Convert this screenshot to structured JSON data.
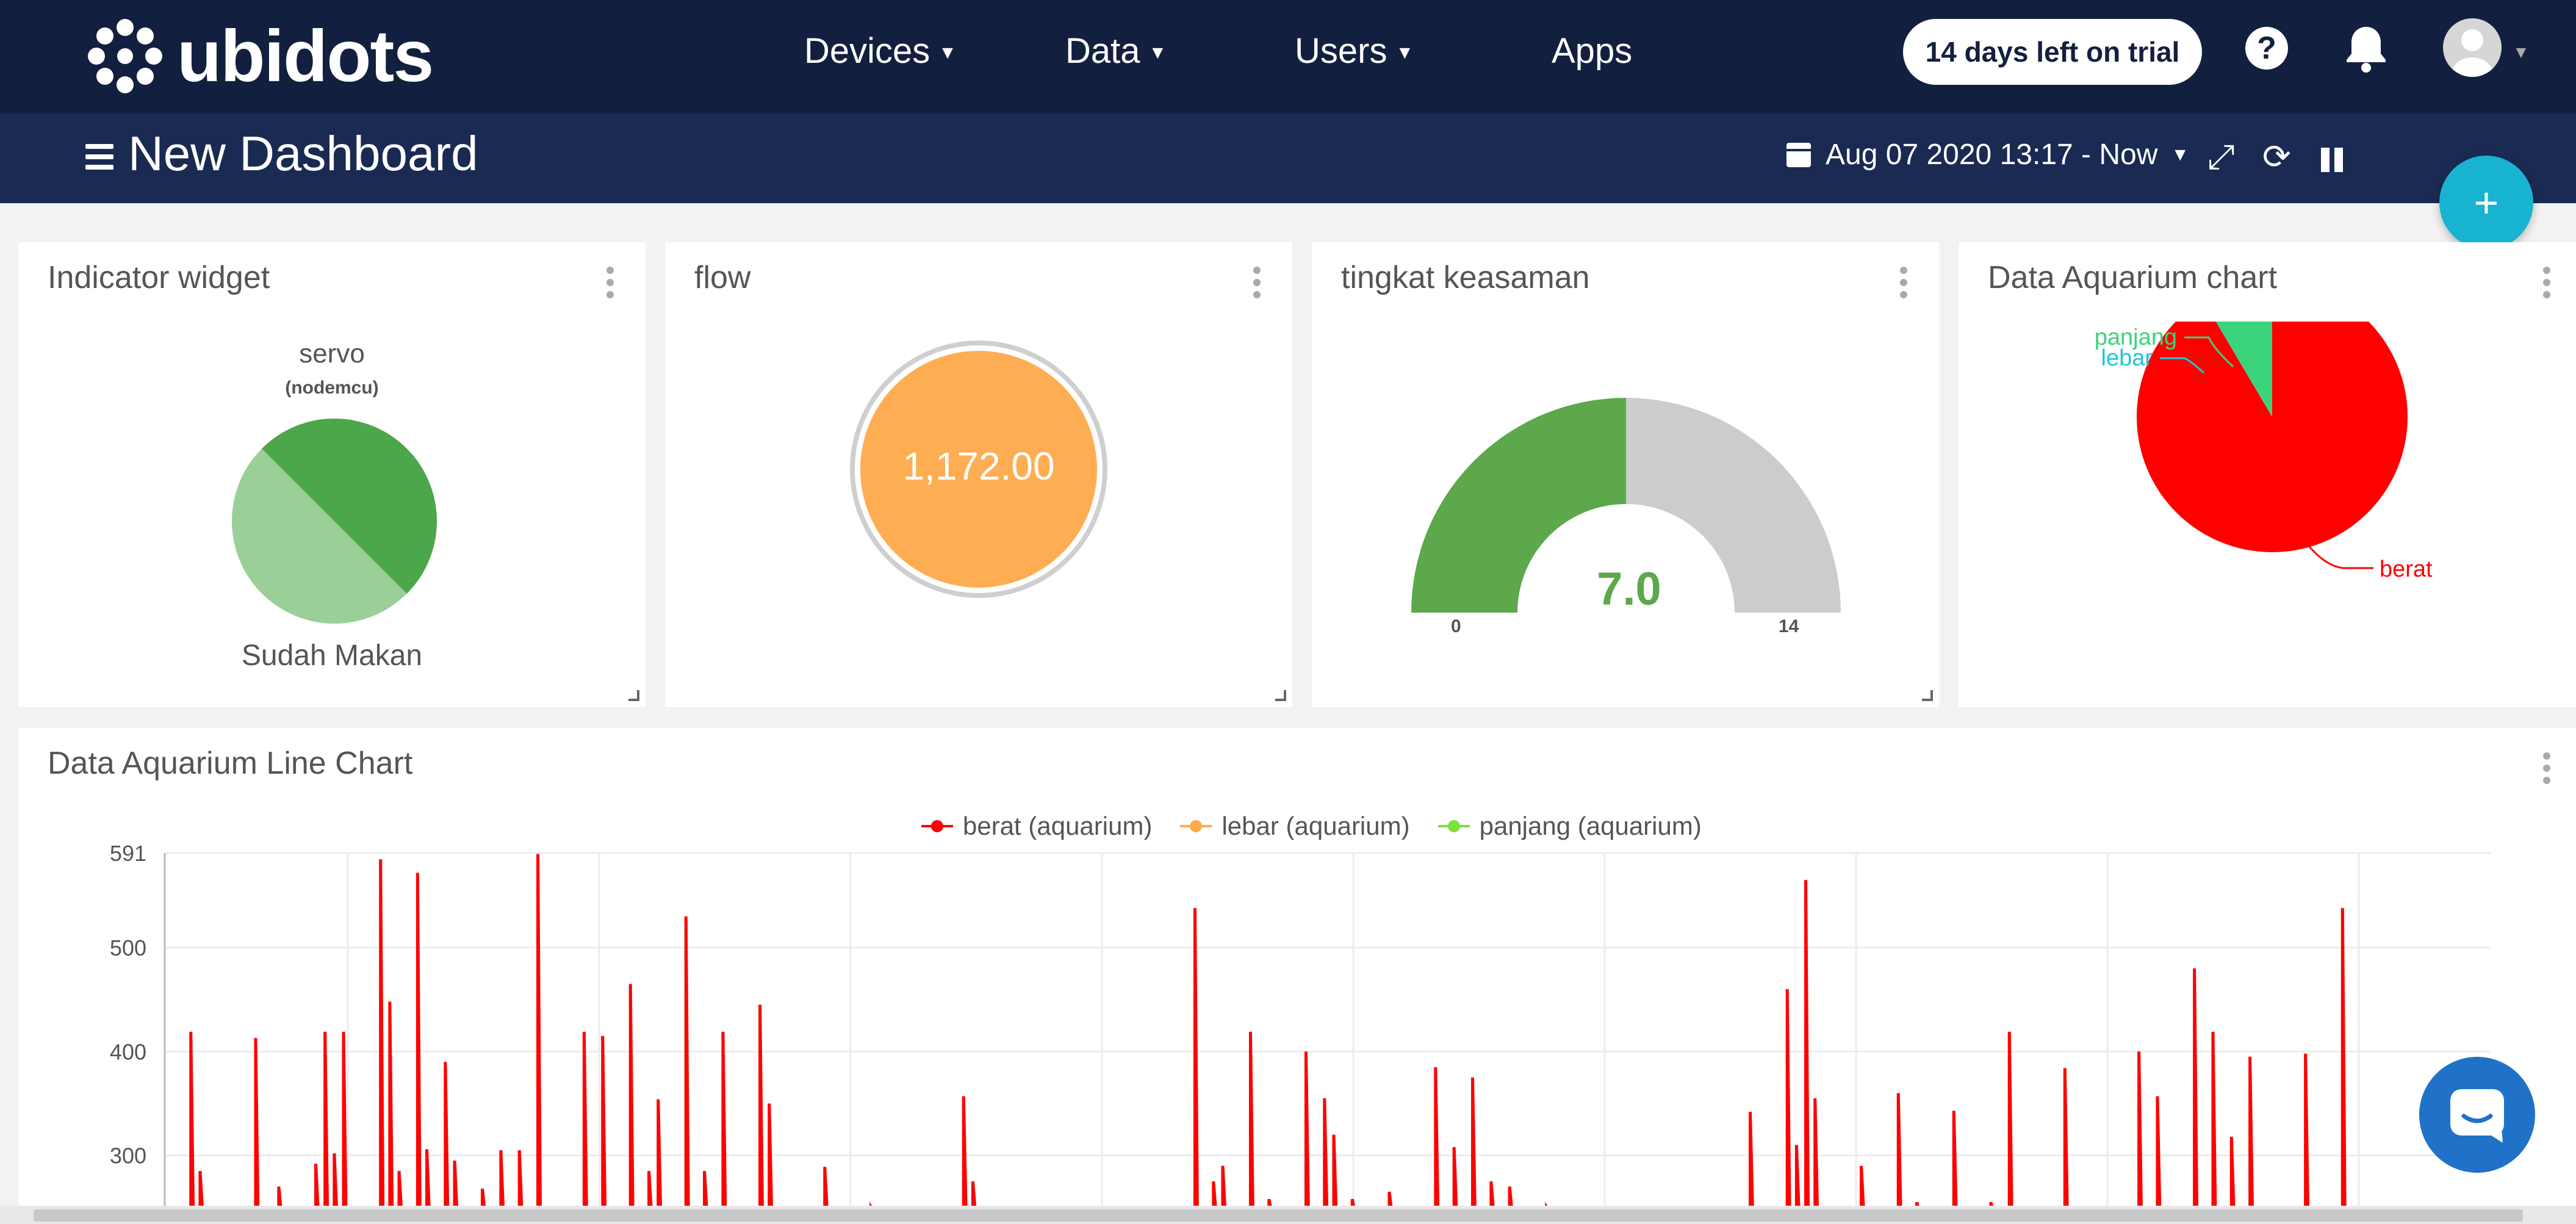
{
  "app": {
    "logo_text": "ubidots"
  },
  "nav": {
    "devices": "Devices",
    "data": "Data",
    "users": "Users",
    "apps": "Apps"
  },
  "trial": "14 days left on trial",
  "dashboard": {
    "title": "New Dashboard",
    "date_range": "Aug 07 2020 13:17 - Now",
    "add_label": "+"
  },
  "widgets": {
    "indicator": {
      "title": "Indicator widget",
      "variable": "servo",
      "device": "(nodemcu)",
      "status": "Sudah Makan"
    },
    "flow": {
      "title": "flow",
      "value": "1,172.00"
    },
    "gauge": {
      "title": "tingkat keasaman",
      "value": "7.0",
      "min": "0",
      "max": "14",
      "value_num": 7.0,
      "min_num": 0,
      "max_num": 14
    },
    "pie": {
      "title": "Data Aquarium chart"
    },
    "line": {
      "title": "Data Aquarium Line Chart"
    }
  },
  "colors": {
    "navy": "#131f3f",
    "navy2": "#1a2a52",
    "accent": "#17b3d1",
    "berat": "#ff0000",
    "lebar": "#ffab4d",
    "panjang": "#7ee03c",
    "gauge": "#5ca84b",
    "flow": "#fead52"
  },
  "chart_data": [
    {
      "type": "pie",
      "title": "Data Aquarium chart",
      "labels": [
        "berat",
        "lebar",
        "panjang"
      ],
      "values": [
        91.5,
        0.1,
        8.4
      ],
      "colors": [
        "#ff0000",
        "#1fc6d6",
        "#3bd47b"
      ]
    },
    {
      "type": "line",
      "title": "Data Aquarium Line Chart",
      "series": [
        {
          "name": "berat  (aquarium)",
          "color": "#ff0000",
          "x": [
            3,
            5,
            17,
            22,
            24,
            26,
            30,
            32,
            34,
            36,
            40,
            44,
            46,
            48,
            52,
            54,
            56,
            58,
            60,
            62,
            66,
            70,
            74,
            78,
            82,
            88,
            92,
            98,
            102,
            104,
            106,
            110,
            114,
            118,
            120,
            122,
            126,
            128,
            130,
            132,
            134,
            136,
            140,
            144,
            148,
            150,
            152,
            154,
            156,
            160,
            164,
            168,
            170,
            172,
            178,
            180,
            182,
            186,
            190,
            194,
            200,
            204,
            208,
            210,
            212,
            216,
            218,
            220,
            224,
            226,
            228,
            232,
            236,
            240,
            244,
            248,
            250,
            252,
            254,
            256,
            258,
            262,
            264,
            266,
            268,
            272,
            276,
            280,
            282,
            284,
            288,
            292,
            296,
            300,
            304,
            310,
            314,
            316,
            320,
            324,
            330,
            336,
            340,
            344,
            348,
            350,
            352,
            354,
            356,
            360,
            364,
            368,
            372,
            376,
            380,
            384,
            388,
            392,
            396,
            400,
            404,
            408,
            412,
            416,
            420,
            424,
            428,
            430,
            432,
            436,
            440,
            444,
            448,
            452,
            456,
            460,
            464,
            468,
            472,
            476,
            480,
            484,
            488,
            490,
            494,
            498
          ],
          "y": [
            419,
            285,
            413,
            270,
            236,
            230,
            292,
            419,
            302,
            419,
            240,
            585,
            448,
            285,
            572,
            306,
            233,
            390,
            295,
            225,
            268,
            305,
            305,
            590,
            240,
            419,
            415,
            465,
            285,
            354,
            230,
            530,
            285,
            419,
            230,
            230,
            445,
            350,
            230,
            220,
            225,
            230,
            289,
            240,
            230,
            250,
            225,
            230,
            230,
            230,
            230,
            230,
            357,
            275,
            230,
            230,
            230,
            230,
            230,
            230,
            230,
            230,
            230,
            230,
            230,
            230,
            230,
            538,
            275,
            290,
            230,
            419,
            258,
            240,
            400,
            355,
            320,
            230,
            258,
            240,
            230,
            265,
            230,
            230,
            230,
            385,
            308,
            375,
            230,
            275,
            270,
            230,
            250,
            230,
            230,
            230,
            230,
            230,
            230,
            230,
            230,
            230,
            342,
            230,
            460,
            310,
            565,
            355,
            230,
            230,
            290,
            230,
            360,
            255,
            230,
            343,
            230,
            255,
            419,
            230,
            230,
            384,
            230,
            230,
            230,
            400,
            357,
            230,
            230,
            480,
            419,
            318,
            395,
            230,
            230,
            398,
            230,
            538,
            230,
            230,
            230,
            230,
            230,
            230,
            230,
            230
          ]
        },
        {
          "name": "lebar  (aquarium)",
          "color": "#ffab4d",
          "x": [],
          "y": []
        },
        {
          "name": "panjang  (aquarium)",
          "color": "#7ee03c",
          "x": [],
          "y": []
        }
      ],
      "yticks": [
        300,
        400,
        500,
        591
      ],
      "ylim": [
        220,
        591
      ]
    }
  ]
}
